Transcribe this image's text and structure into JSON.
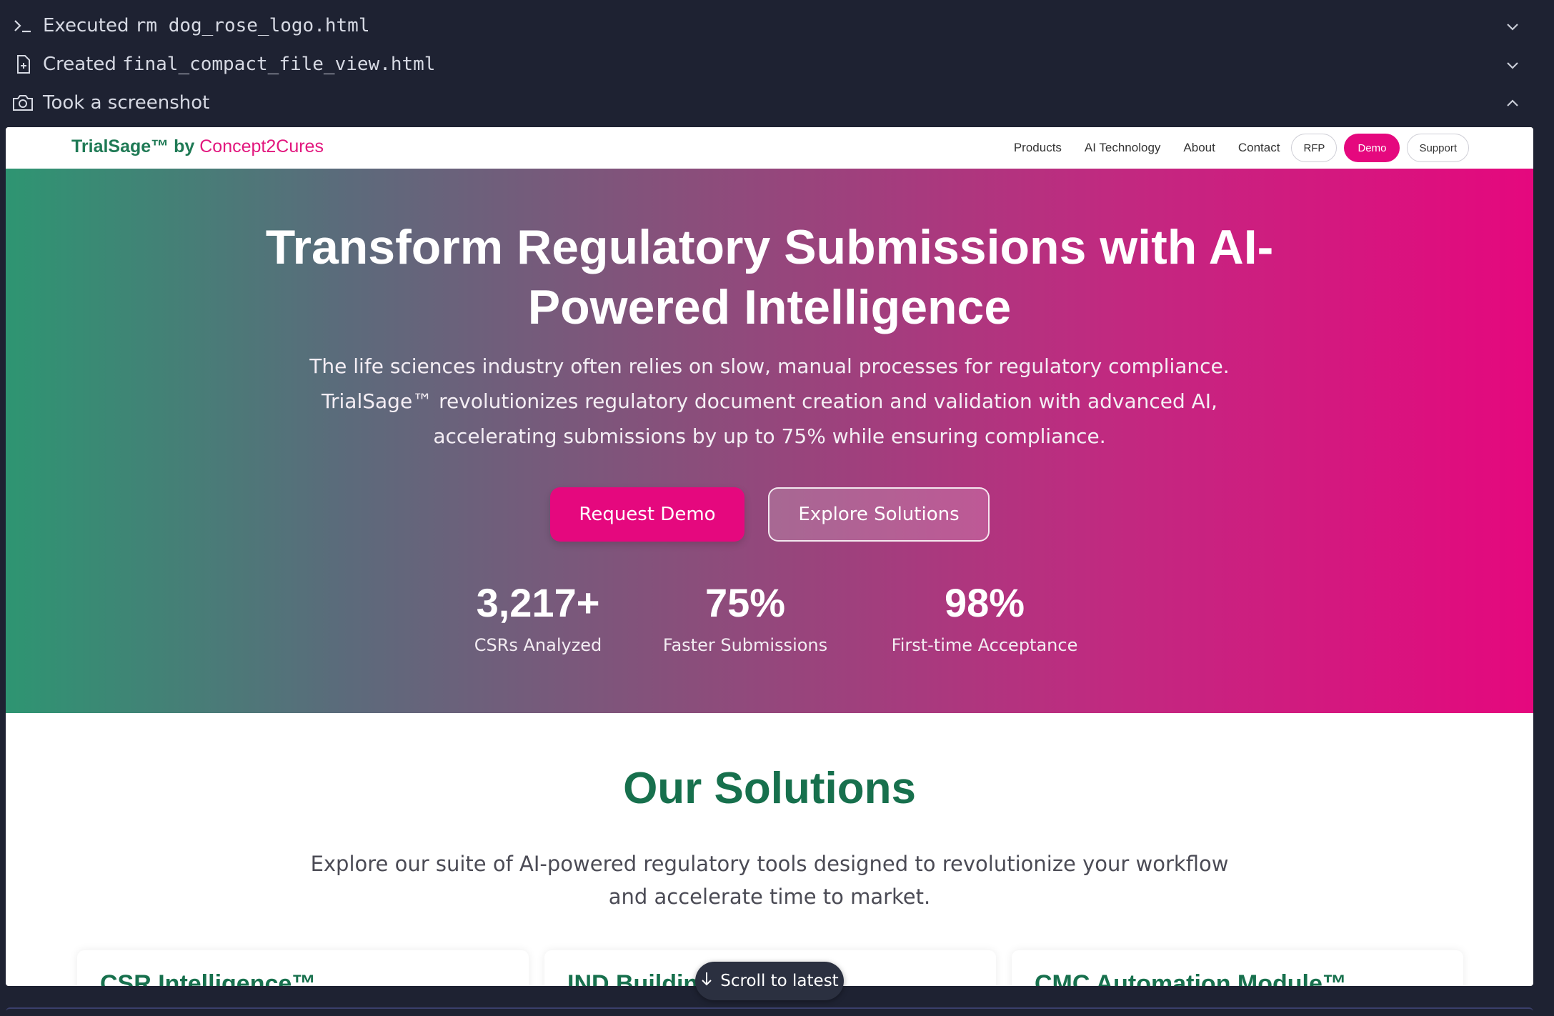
{
  "activity_log": [
    {
      "icon": "terminal-icon",
      "prefix": "Executed",
      "detail": "rm dog_rose_logo.html",
      "chevron": "chevron-down-icon"
    },
    {
      "icon": "file-plus-icon",
      "prefix": "Created",
      "detail": "final_compact_file_view.html",
      "chevron": "chevron-down-icon"
    },
    {
      "icon": "camera-icon",
      "prefix": "Took a screenshot",
      "detail": "",
      "chevron": "chevron-up-icon"
    }
  ],
  "site": {
    "brand_main": "TrialSage™ by",
    "brand_accent": "Concept2Cures",
    "nav": [
      "Products",
      "AI Technology",
      "About",
      "Contact"
    ],
    "pills": {
      "rfp": "RFP",
      "demo": "Demo",
      "support": "Support"
    },
    "hero": {
      "title_line1": "Transform Regulatory Submissions with AI-",
      "title_line2": "Powered Intelligence",
      "lead_line1": "The life sciences industry often relies on slow, manual processes for regulatory compliance.",
      "lead_line2": "TrialSage™ revolutionizes regulatory document creation and validation with advanced AI,",
      "lead_line3": "accelerating submissions by up to 75% while ensuring compliance.",
      "primary_button": "Request Demo",
      "secondary_button": "Explore Solutions",
      "stats": [
        {
          "value": "3,217+",
          "label": "CSRs Analyzed"
        },
        {
          "value": "75%",
          "label": "Faster Submissions"
        },
        {
          "value": "98%",
          "label": "First-time Acceptance"
        }
      ]
    },
    "solutions": {
      "title": "Our Solutions",
      "lead_line1": "Explore our suite of AI-powered regulatory tools designed to revolutionize your workflow",
      "lead_line2": "and accelerate time to market.",
      "cards": [
        "CSR Intelligence™",
        "IND Building Wizard™",
        "CMC Automation Module™"
      ]
    }
  },
  "scroll_button": "Scroll to latest",
  "colors": {
    "brand_green": "#17704d",
    "brand_pink": "#e5087e",
    "app_bg": "#1e2232"
  }
}
